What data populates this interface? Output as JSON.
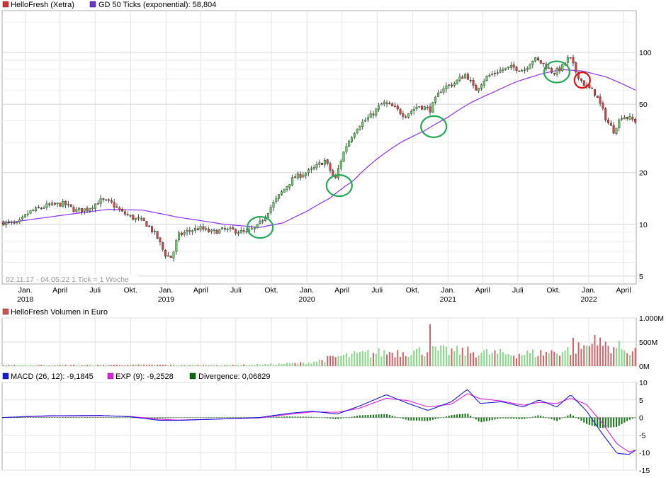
{
  "chart_data": [
    {
      "type": "candlestick",
      "legend": [
        {
          "label": "HelloFresh (Xetra)",
          "color": "#cc3333"
        },
        {
          "label": "GD 50 Ticks (exponential): 58,804",
          "color": "#6633cc"
        }
      ],
      "range_note": "02.11.17 - 04.05.22   1 Tick = 1 Woche",
      "y_scale": "log",
      "ylim": [
        4.5,
        175
      ],
      "y_ticks": [
        5,
        10,
        20,
        50,
        100
      ],
      "y_tick_labels": [
        "5",
        "10",
        "20",
        "50",
        "100"
      ],
      "x_range": [
        "2017-11-02",
        "2022-05-04"
      ],
      "x_ticks": [
        {
          "date": "2018-01-01",
          "label": "Jan."
        },
        {
          "date": "2018-04-01",
          "label": "April"
        },
        {
          "date": "2018-07-01",
          "label": "Juli"
        },
        {
          "date": "2018-10-01",
          "label": "Okt."
        },
        {
          "date": "2019-01-01",
          "label": "Jan."
        },
        {
          "date": "2019-04-01",
          "label": "April"
        },
        {
          "date": "2019-07-01",
          "label": "Juli"
        },
        {
          "date": "2019-10-01",
          "label": "Okt."
        },
        {
          "date": "2020-01-01",
          "label": "Jan."
        },
        {
          "date": "2020-04-01",
          "label": "April"
        },
        {
          "date": "2020-07-01",
          "label": "Juli"
        },
        {
          "date": "2020-10-01",
          "label": "Okt."
        },
        {
          "date": "2021-01-01",
          "label": "Jan."
        },
        {
          "date": "2021-04-01",
          "label": "April"
        },
        {
          "date": "2021-07-01",
          "label": "Juli"
        },
        {
          "date": "2021-10-01",
          "label": "Okt."
        },
        {
          "date": "2022-01-01",
          "label": "Jan."
        },
        {
          "date": "2022-04-01",
          "label": "April"
        }
      ],
      "year_labels": [
        {
          "date": "2018-01-01",
          "label": "2018"
        },
        {
          "date": "2019-01-01",
          "label": "2019"
        },
        {
          "date": "2020-01-01",
          "label": "2020"
        },
        {
          "date": "2021-01-01",
          "label": "2021"
        },
        {
          "date": "2022-01-01",
          "label": "2022"
        }
      ],
      "price_path": [
        [
          "2017-11-02",
          10.3
        ],
        [
          "2017-12-15",
          10.0
        ],
        [
          "2018-01-15",
          11.8
        ],
        [
          "2018-03-01",
          12.8
        ],
        [
          "2018-04-15",
          13.2
        ],
        [
          "2018-05-15",
          12.0
        ],
        [
          "2018-06-15",
          12.3
        ],
        [
          "2018-07-20",
          13.8
        ],
        [
          "2018-08-15",
          13.3
        ],
        [
          "2018-09-10",
          11.8
        ],
        [
          "2018-10-10",
          10.9
        ],
        [
          "2018-11-10",
          10.3
        ],
        [
          "2018-12-10",
          8.6
        ],
        [
          "2019-01-01",
          6.7
        ],
        [
          "2019-01-20",
          6.4
        ],
        [
          "2019-02-05",
          8.6
        ],
        [
          "2019-03-01",
          9.1
        ],
        [
          "2019-04-01",
          9.5
        ],
        [
          "2019-05-01",
          9.0
        ],
        [
          "2019-06-01",
          9.3
        ],
        [
          "2019-07-01",
          9.2
        ],
        [
          "2019-08-01",
          8.9
        ],
        [
          "2019-09-01",
          9.8
        ],
        [
          "2019-10-01",
          12.4
        ],
        [
          "2019-11-01",
          15.4
        ],
        [
          "2019-12-01",
          18.6
        ],
        [
          "2020-01-15",
          20.5
        ],
        [
          "2020-02-20",
          23.5
        ],
        [
          "2020-03-18",
          18.0
        ],
        [
          "2020-04-15",
          28.5
        ],
        [
          "2020-05-15",
          37.0
        ],
        [
          "2020-06-20",
          43.0
        ],
        [
          "2020-07-20",
          51.0
        ],
        [
          "2020-08-15",
          48.0
        ],
        [
          "2020-09-15",
          43.0
        ],
        [
          "2020-10-20",
          49.0
        ],
        [
          "2020-11-20",
          46.5
        ],
        [
          "2020-12-20",
          62.0
        ],
        [
          "2021-01-20",
          66.0
        ],
        [
          "2021-02-20",
          75.0
        ],
        [
          "2021-03-15",
          60.0
        ],
        [
          "2021-04-15",
          72.0
        ],
        [
          "2021-05-15",
          78.0
        ],
        [
          "2021-06-20",
          82.0
        ],
        [
          "2021-07-20",
          79.0
        ],
        [
          "2021-08-15",
          92.0
        ],
        [
          "2021-09-10",
          85.0
        ],
        [
          "2021-10-05",
          76.0
        ],
        [
          "2021-10-25",
          81.0
        ],
        [
          "2021-11-15",
          94.0
        ],
        [
          "2021-12-01",
          78.0
        ],
        [
          "2021-12-20",
          66.0
        ],
        [
          "2022-01-20",
          58.0
        ],
        [
          "2022-02-20",
          40.0
        ],
        [
          "2022-03-10",
          35.0
        ],
        [
          "2022-04-01",
          43.0
        ],
        [
          "2022-05-04",
          40.0
        ]
      ],
      "moving_average_path": [
        [
          "2017-11-02",
          10.1
        ],
        [
          "2018-03-01",
          11.0
        ],
        [
          "2018-08-01",
          12.2
        ],
        [
          "2018-11-01",
          12.1
        ],
        [
          "2019-02-01",
          11.0
        ],
        [
          "2019-06-01",
          10.0
        ],
        [
          "2019-09-01",
          9.6
        ],
        [
          "2019-11-01",
          10.2
        ],
        [
          "2020-01-01",
          11.9
        ],
        [
          "2020-03-01",
          14.2
        ],
        [
          "2020-05-01",
          18.0
        ],
        [
          "2020-07-01",
          24.0
        ],
        [
          "2020-09-01",
          30.0
        ],
        [
          "2020-11-01",
          35.0
        ],
        [
          "2021-01-01",
          42.0
        ],
        [
          "2021-03-01",
          51.0
        ],
        [
          "2021-05-01",
          59.0
        ],
        [
          "2021-07-01",
          68.0
        ],
        [
          "2021-09-01",
          75.0
        ],
        [
          "2021-10-20",
          79.5
        ],
        [
          "2021-12-15",
          78.0
        ],
        [
          "2022-02-15",
          72.0
        ],
        [
          "2022-05-04",
          60.0
        ]
      ],
      "annotations": [
        {
          "shape": "ellipse",
          "color": "#22aa55",
          "date": "2019-09-02",
          "value": 9.6
        },
        {
          "shape": "ellipse",
          "color": "#22aa55",
          "date": "2020-03-25",
          "value": 16.8
        },
        {
          "shape": "ellipse",
          "color": "#22aa55",
          "date": "2020-11-25",
          "value": 37.0
        },
        {
          "shape": "ellipse",
          "color": "#22aa55",
          "date": "2021-10-10",
          "value": 77.0
        },
        {
          "shape": "ellipse",
          "color": "#dd1111",
          "date": "2021-12-15",
          "value": 69.0
        }
      ]
    },
    {
      "type": "bar",
      "legend": [
        {
          "label": "HelloFresh Volumen in Euro",
          "color": "#cc5555"
        }
      ],
      "ylim": [
        0,
        1000000000
      ],
      "y_ticks": [
        0,
        500000000,
        1000000000
      ],
      "y_tick_labels": [
        "0M",
        "500M",
        "1.000M"
      ],
      "volume_path": [
        [
          "2017-11-02",
          20
        ],
        [
          "2018-06-01",
          22
        ],
        [
          "2018-12-01",
          28
        ],
        [
          "2019-03-01",
          20
        ],
        [
          "2019-07-01",
          22
        ],
        [
          "2019-10-01",
          40
        ],
        [
          "2020-01-01",
          70
        ],
        [
          "2020-03-15",
          190
        ],
        [
          "2020-06-01",
          260
        ],
        [
          "2020-09-01",
          300
        ],
        [
          "2020-12-01",
          320
        ],
        [
          "2021-03-01",
          290
        ],
        [
          "2021-06-01",
          250
        ],
        [
          "2021-09-01",
          270
        ],
        [
          "2021-11-15",
          340
        ],
        [
          "2022-01-15",
          460
        ],
        [
          "2022-03-01",
          410
        ],
        [
          "2022-05-04",
          300
        ]
      ],
      "volume_spikes": [
        [
          "2020-11-15",
          870
        ],
        [
          "2022-01-10",
          650
        ],
        [
          "2021-11-20",
          590
        ]
      ],
      "volume_units": "M"
    },
    {
      "type": "line",
      "legend": [
        {
          "label": "MACD (26, 12): -9,1845",
          "color": "#1a1ad4"
        },
        {
          "label": "EXP (9): -9,2528",
          "color": "#dd22dd"
        },
        {
          "label": "Divergence: 0,06829",
          "color": "#116611"
        }
      ],
      "ylim": [
        -15,
        10
      ],
      "y_ticks": [
        -15,
        -10,
        -5,
        0,
        5,
        10
      ],
      "y_tick_labels": [
        "-15",
        "-10",
        "-5",
        "0",
        "5",
        "10"
      ],
      "macd_path": [
        [
          "2017-11-02",
          0.0
        ],
        [
          "2018-03-01",
          0.5
        ],
        [
          "2018-07-15",
          0.6
        ],
        [
          "2018-10-01",
          0.2
        ],
        [
          "2018-12-15",
          -0.8
        ],
        [
          "2019-02-01",
          -0.8
        ],
        [
          "2019-05-01",
          -0.5
        ],
        [
          "2019-09-01",
          0.0
        ],
        [
          "2019-11-15",
          1.2
        ],
        [
          "2020-01-15",
          1.8
        ],
        [
          "2020-03-20",
          1.0
        ],
        [
          "2020-05-15",
          3.2
        ],
        [
          "2020-07-25",
          6.5
        ],
        [
          "2020-09-20",
          4.0
        ],
        [
          "2020-11-10",
          2.0
        ],
        [
          "2021-01-10",
          4.5
        ],
        [
          "2021-02-20",
          8.0
        ],
        [
          "2021-03-25",
          4.0
        ],
        [
          "2021-05-20",
          4.5
        ],
        [
          "2021-07-15",
          3.0
        ],
        [
          "2021-08-25",
          5.0
        ],
        [
          "2021-10-10",
          3.0
        ],
        [
          "2021-11-15",
          6.5
        ],
        [
          "2021-12-25",
          2.0
        ],
        [
          "2022-02-01",
          -4.0
        ],
        [
          "2022-03-15",
          -10.2
        ],
        [
          "2022-04-15",
          -10.5
        ],
        [
          "2022-05-04",
          -9.2
        ]
      ],
      "signal_path": [
        [
          "2017-11-02",
          0.0
        ],
        [
          "2018-03-01",
          0.4
        ],
        [
          "2018-07-15",
          0.5
        ],
        [
          "2018-10-01",
          0.3
        ],
        [
          "2018-12-15",
          -0.5
        ],
        [
          "2019-02-01",
          -0.7
        ],
        [
          "2019-05-01",
          -0.5
        ],
        [
          "2019-09-01",
          -0.1
        ],
        [
          "2019-11-15",
          0.9
        ],
        [
          "2020-01-15",
          1.6
        ],
        [
          "2020-03-20",
          1.5
        ],
        [
          "2020-05-15",
          2.6
        ],
        [
          "2020-07-25",
          5.5
        ],
        [
          "2020-09-20",
          4.8
        ],
        [
          "2020-11-10",
          3.0
        ],
        [
          "2021-01-10",
          3.8
        ],
        [
          "2021-02-20",
          6.8
        ],
        [
          "2021-03-25",
          5.4
        ],
        [
          "2021-05-20",
          4.7
        ],
        [
          "2021-07-15",
          3.5
        ],
        [
          "2021-08-25",
          4.3
        ],
        [
          "2021-10-10",
          4.0
        ],
        [
          "2021-11-15",
          5.5
        ],
        [
          "2021-12-25",
          3.8
        ],
        [
          "2022-02-01",
          -1.0
        ],
        [
          "2022-03-15",
          -7.5
        ],
        [
          "2022-04-15",
          -9.8
        ],
        [
          "2022-05-04",
          -9.25
        ]
      ]
    }
  ]
}
